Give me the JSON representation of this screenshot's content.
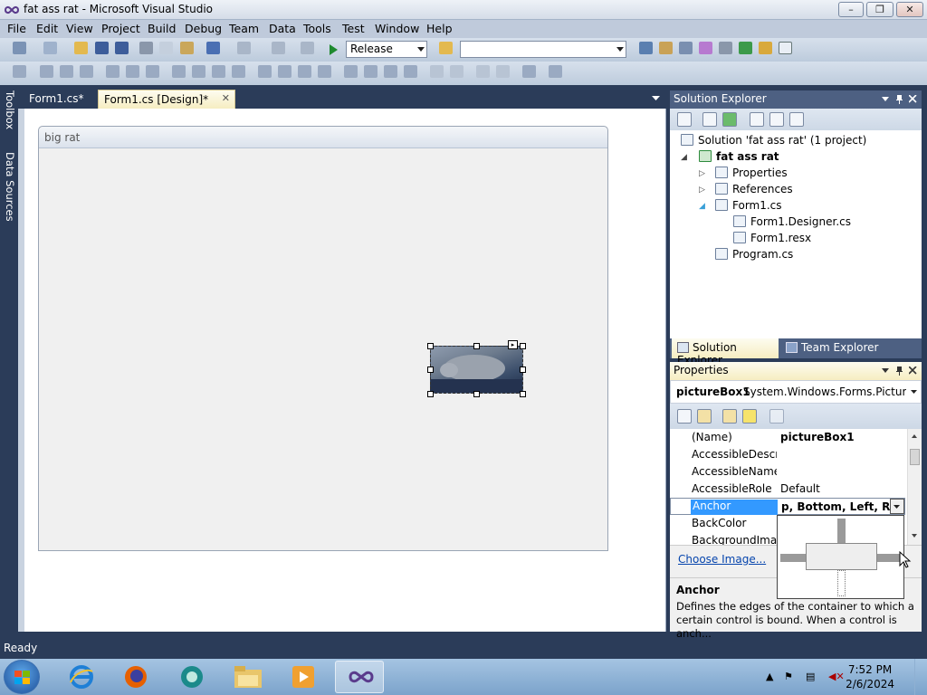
{
  "window": {
    "title": "fat ass rat - Microsoft Visual Studio",
    "minimize": "–",
    "restore": "❐",
    "close": "✕"
  },
  "menu": [
    "File",
    "Edit",
    "View",
    "Project",
    "Build",
    "Debug",
    "Team",
    "Data",
    "Tools",
    "Test",
    "Window",
    "Help"
  ],
  "toolbar": {
    "configuration": "Release",
    "platform": ""
  },
  "left_strip": {
    "toolbox": "Toolbox",
    "data_sources": "Data Sources"
  },
  "doc_tabs": [
    {
      "label": "Form1.cs*"
    },
    {
      "label": "Form1.cs [Design]*"
    }
  ],
  "doc_tabs_close": "✕",
  "form": {
    "title": "big rat"
  },
  "solution_explorer": {
    "title": "Solution Explorer",
    "tree": {
      "solution": "Solution 'fat ass rat' (1 project)",
      "project": "fat ass rat",
      "properties": "Properties",
      "references": "References",
      "form1": "Form1.cs",
      "designer": "Form1.Designer.cs",
      "resx": "Form1.resx",
      "program": "Program.cs"
    },
    "bottom_tabs": [
      "Solution Explorer",
      "Team Explorer"
    ]
  },
  "properties": {
    "title": "Properties",
    "object_name": "pictureBox1",
    "object_type": "System.Windows.Forms.PictureBo",
    "rows": [
      {
        "name": "(Name)",
        "value": "pictureBox1"
      },
      {
        "name": "AccessibleDescription",
        "value": ""
      },
      {
        "name": "AccessibleName",
        "value": ""
      },
      {
        "name": "AccessibleRole",
        "value": "Default"
      },
      {
        "name": "Anchor",
        "value": "p, Bottom, Left, Right"
      },
      {
        "name": "BackColor",
        "value": ""
      },
      {
        "name": "BackgroundImage",
        "value": ""
      }
    ],
    "command_link": "Choose Image...",
    "description_title": "Anchor",
    "description_text": "Defines the edges of the container to which a certain control is bound. When a control is anch..."
  },
  "status": {
    "text": "Ready"
  },
  "taskbar": {
    "time": "7:52 PM",
    "date": "2/6/2024"
  },
  "colors": {
    "ide_background": "#2b3c59",
    "selection": "#3399ff",
    "active_tab": "#f6edc1"
  }
}
